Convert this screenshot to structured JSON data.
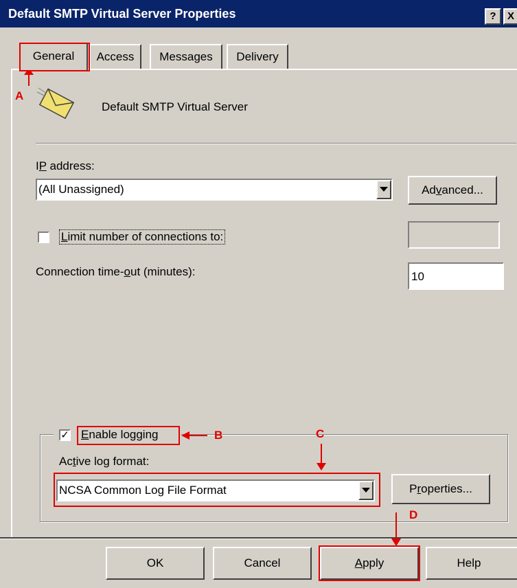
{
  "window": {
    "title": "Default SMTP Virtual Server Properties",
    "help_button": "?",
    "close_button": "X"
  },
  "tabs": [
    {
      "label": "General",
      "active": true
    },
    {
      "label": "Access",
      "active": false
    },
    {
      "label": "Messages",
      "active": false
    },
    {
      "label": "Delivery",
      "active": false
    }
  ],
  "general": {
    "server_name": "Default SMTP Virtual Server",
    "ip_address_label_pre": "I",
    "ip_address_label_u": "P",
    "ip_address_label_post": " address:",
    "ip_address_value": "(All Unassigned)",
    "advanced_pre": "Ad",
    "advanced_u": "v",
    "advanced_post": "anced...",
    "limit_connections_pre": "",
    "limit_connections_u": "L",
    "limit_connections_post": "imit number of connections to:",
    "limit_connections_checked": false,
    "limit_connections_value": "",
    "timeout_label_pre": "Connection time-",
    "timeout_label_u": "o",
    "timeout_label_post": "ut (minutes):",
    "timeout_value": "10"
  },
  "logging": {
    "enable_pre": "",
    "enable_u": "E",
    "enable_post": "nable logging",
    "enabled": true,
    "format_label_pre": "Ac",
    "format_label_u": "t",
    "format_label_post": "ive log format:",
    "format_value": "NCSA Common Log File Format",
    "properties_pre": "P",
    "properties_u": "r",
    "properties_post": "operties..."
  },
  "buttons": {
    "ok": "OK",
    "cancel": "Cancel",
    "apply_u": "A",
    "apply_post": "pply",
    "help": "Help"
  },
  "annotations": {
    "a": "A",
    "b": "B",
    "c": "C",
    "d": "D",
    "color": "#e00000"
  },
  "icons": {
    "server": "envelope-icon",
    "dropdown": "down-triangle-icon"
  }
}
